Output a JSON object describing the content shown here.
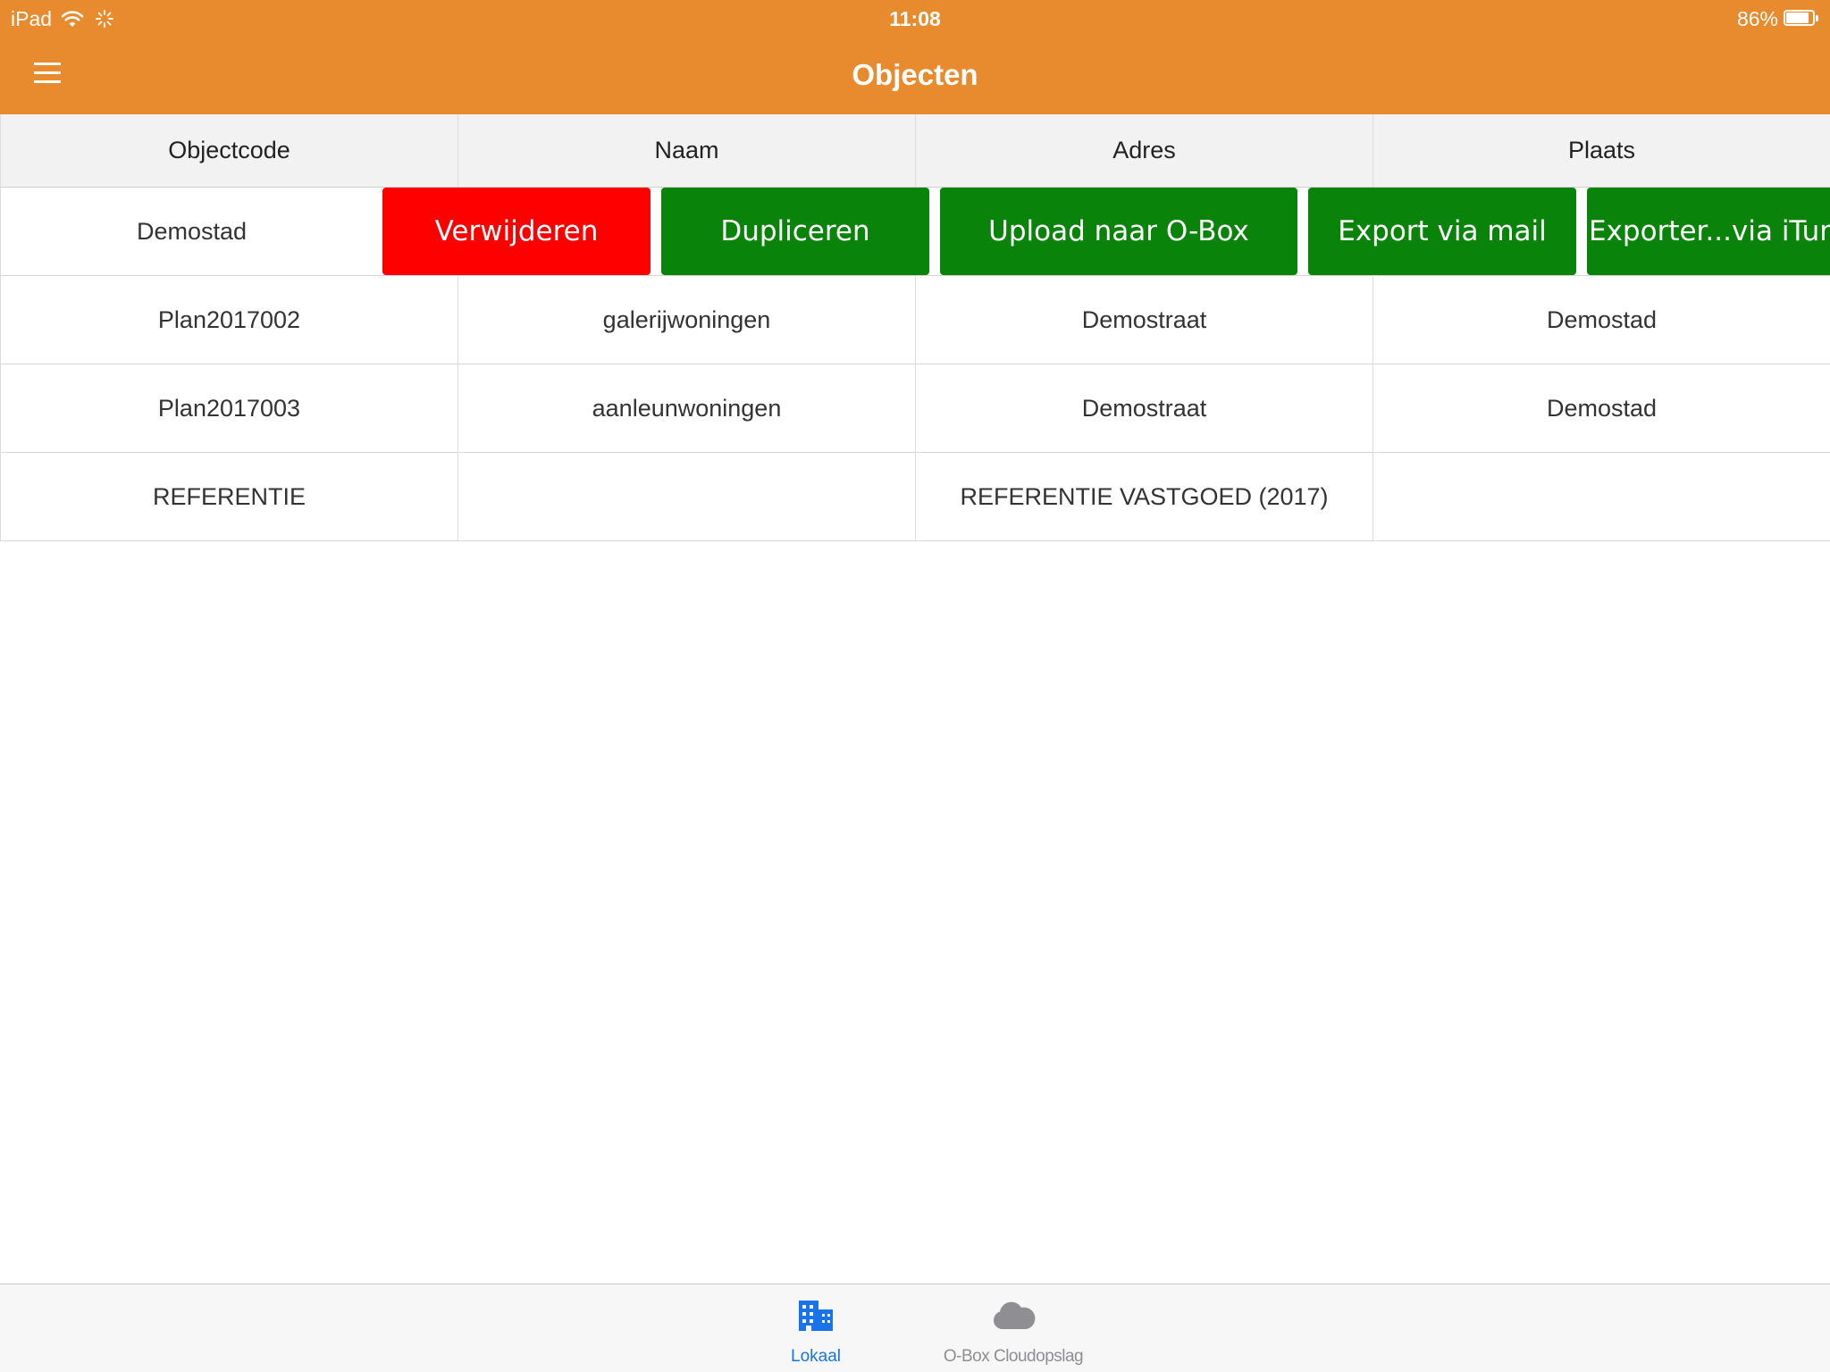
{
  "status_bar": {
    "carrier": "iPad",
    "time": "11:08",
    "battery_percent_label": "86%",
    "battery_level": 0.86
  },
  "nav": {
    "title": "Objecten",
    "menu_icon": "hamburger-menu-icon"
  },
  "table": {
    "columns": [
      "Objectcode",
      "Naam",
      "Adres",
      "Plaats"
    ],
    "swiped_row": {
      "objectcode": "Demostad",
      "actions": [
        "Verwijderen",
        "Dupliceren",
        "Upload naar O-Box",
        "Export via mail",
        "Exporter...via iTunes"
      ]
    },
    "rows": [
      [
        "Plan2017002",
        "galerijwoningen",
        "Demostraat",
        "Demostad"
      ],
      [
        "Plan2017003",
        "aanleunwoningen",
        "Demostraat",
        "Demostad"
      ],
      [
        "REFERENTIE",
        "",
        "REFERENTIE VASTGOED (2017)",
        ""
      ]
    ]
  },
  "colors": {
    "nav_background": "#e88a2e",
    "delete_button": "#ff0000",
    "action_button": "#0a830a",
    "active_tab": "#1a73e8"
  },
  "tabbar": {
    "tabs": [
      {
        "label": "Lokaal",
        "icon": "building-icon",
        "active": true
      },
      {
        "label": "O-Box Cloudopslag",
        "icon": "cloud-icon",
        "active": false
      }
    ]
  }
}
